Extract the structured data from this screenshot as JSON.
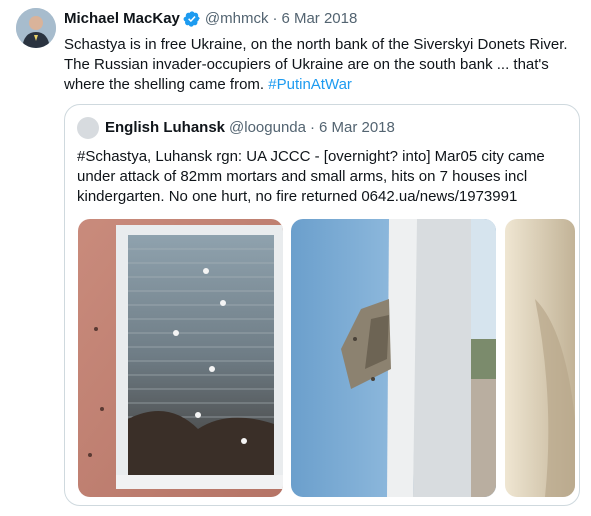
{
  "tweet": {
    "author_name": "Michael MacKay",
    "handle": "@mhmck",
    "date": "6 Mar 2018",
    "text_main": "Schastya is in free Ukraine, on the north bank of the Siverskyi Donets River. The Russian invader-occupiers of Ukraine are on the south bank ... that's where the shelling came from.",
    "hashtag": "#PutinAtWar",
    "verified_icon": "verified-badge-icon"
  },
  "quote": {
    "author_name": "English Luhansk",
    "handle": "@loogunda",
    "date": "6 Mar 2018",
    "text": "#Schastya, Luhansk rgn: UA JCCC - [overnight? into] Mar05 city came under attack of 82mm mortars and small arms, hits on 7 houses incl kindergarten. No one hurt, no fire returned 0642.ua/news/1973991"
  },
  "colors": {
    "link": "#1d9bf0",
    "verified": "#1d9bf0",
    "muted_text": "#536471",
    "border": "#cfd9de"
  },
  "separator": "·"
}
